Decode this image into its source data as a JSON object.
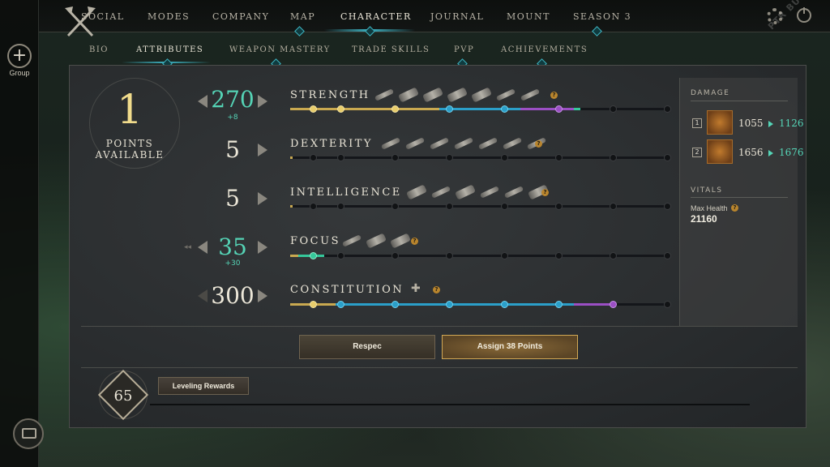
{
  "left_rail": {
    "group_label": "Group",
    "group_icon": "plus-icon",
    "chat_icon": "chat-icon"
  },
  "top_nav": {
    "items": [
      "SOCIAL",
      "MODES",
      "COMPANY",
      "MAP",
      "CHARACTER",
      "JOURNAL",
      "MOUNT",
      "SEASON 3"
    ],
    "active": "CHARACTER"
  },
  "build_tag": "PTR BUILD",
  "sub_nav": {
    "items": [
      "BIO",
      "ATTRIBUTES",
      "WEAPON MASTERY",
      "TRADE SKILLS",
      "PVP",
      "ACHIEVEMENTS"
    ],
    "active": "ATTRIBUTES"
  },
  "points": {
    "value": "1",
    "label_line1": "POINTS",
    "label_line2": "AVAILABLE"
  },
  "attributes": [
    {
      "name": "STRENGTH",
      "value": "270",
      "bonus": "+8",
      "highlight": true
    },
    {
      "name": "DEXTERITY",
      "value": "5",
      "bonus": "",
      "highlight": false
    },
    {
      "name": "INTELLIGENCE",
      "value": "5",
      "bonus": "",
      "highlight": false
    },
    {
      "name": "FOCUS",
      "value": "35",
      "bonus": "+30",
      "highlight": true
    },
    {
      "name": "CONSTITUTION",
      "value": "300",
      "bonus": "",
      "highlight": false
    }
  ],
  "damage": {
    "title": "DAMAGE",
    "slots": [
      {
        "key": "1",
        "current": "1055",
        "new": "1126"
      },
      {
        "key": "2",
        "current": "1656",
        "new": "1676"
      }
    ]
  },
  "vitals": {
    "title": "VITALS",
    "max_health_label": "Max Health",
    "max_health_value": "21160"
  },
  "actions": {
    "respec": "Respec",
    "assign": "Assign 38 Points"
  },
  "level": {
    "value": "65",
    "rewards_label": "Leveling Rewards"
  },
  "colors": {
    "accent_teal": "#3db4c4",
    "gain_green": "#55d4b6",
    "gold": "#f1dc8c"
  }
}
